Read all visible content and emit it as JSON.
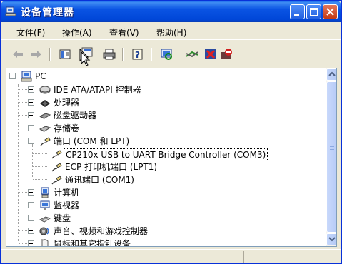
{
  "window": {
    "title": "设备管理器",
    "buttons": {
      "minimize": "minimize",
      "maximize": "maximize",
      "close": "close"
    }
  },
  "menu": [
    {
      "label": "文件(F)"
    },
    {
      "label": "操作(A)"
    },
    {
      "label": "查看(V)"
    },
    {
      "label": "帮助(H)"
    }
  ],
  "toolbar": {
    "icons": [
      "back-arrow-icon",
      "forward-arrow-icon",
      "show-hide-tree-icon",
      "properties-icon",
      "print-icon",
      "help-icon",
      "scan-hardware-icon",
      "update-driver-icon",
      "uninstall-icon",
      "disable-icon"
    ]
  },
  "tree": {
    "root": "PC",
    "items": [
      {
        "label": "IDE ATA/ATAPI 控制器",
        "icon": "ide-controller-icon",
        "expanded": false
      },
      {
        "label": "处理器",
        "icon": "processor-icon",
        "expanded": false
      },
      {
        "label": "磁盘驱动器",
        "icon": "disk-drive-icon",
        "expanded": false
      },
      {
        "label": "存储卷",
        "icon": "storage-volume-icon",
        "expanded": false
      },
      {
        "label": "端口 (COM 和 LPT)",
        "icon": "port-icon",
        "expanded": true,
        "children": [
          {
            "label": "CP210x USB to UART Bridge Controller (COM3)",
            "selected": true
          },
          {
            "label": "ECP 打印机端口 (LPT1)"
          },
          {
            "label": "通讯端口 (COM1)"
          }
        ]
      },
      {
        "label": "计算机",
        "icon": "computer-icon",
        "expanded": false
      },
      {
        "label": "监视器",
        "icon": "monitor-icon",
        "expanded": false
      },
      {
        "label": "键盘",
        "icon": "keyboard-icon",
        "expanded": false
      },
      {
        "label": "声音、视频和游戏控制器",
        "icon": "sound-icon",
        "expanded": false
      },
      {
        "label": "鼠标和其它指针设备",
        "icon": "mouse-icon",
        "expanded": false
      }
    ]
  },
  "colors": {
    "titlebar": "#0a54e3",
    "window_bg": "#ece9d8",
    "selection_border": "#000000"
  }
}
